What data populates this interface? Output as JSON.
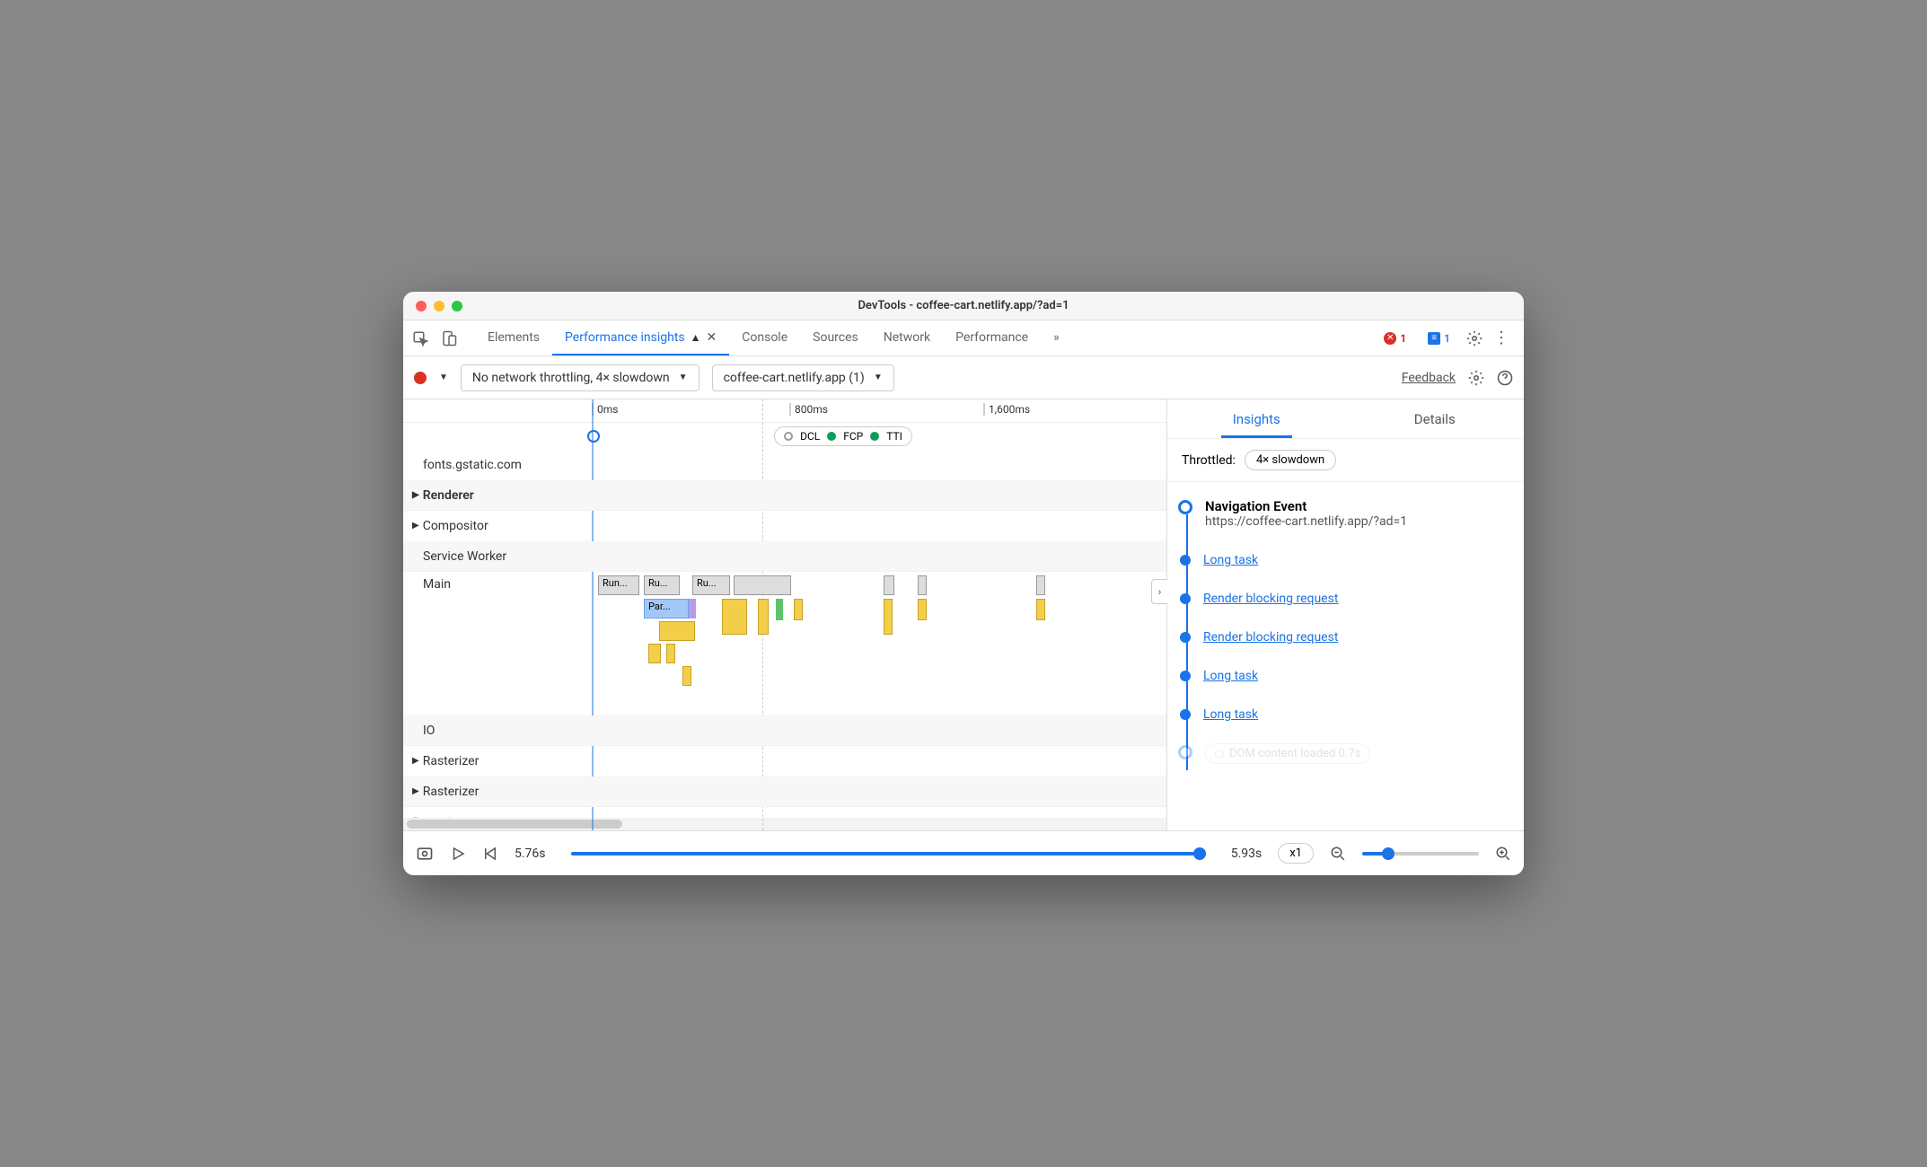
{
  "window": {
    "title": "DevTools - coffee-cart.netlify.app/?ad=1"
  },
  "tabs": {
    "items": [
      "Elements",
      "Performance insights",
      "Console",
      "Sources",
      "Network",
      "Performance"
    ],
    "active_index": 1,
    "more_glyph": "»",
    "error_count": "1",
    "info_count": "1"
  },
  "toolbar": {
    "throttling": "No network throttling, 4× slowdown",
    "target": "coffee-cart.netlify.app (1)",
    "feedback_label": "Feedback"
  },
  "ruler": {
    "ticks": [
      "0ms",
      "800ms",
      "1,600ms"
    ]
  },
  "markers": {
    "dcl": "DCL",
    "fcp": "FCP",
    "tti": "TTI"
  },
  "tracks": {
    "fonts": "fonts.gstatic.com",
    "renderer": "Renderer",
    "compositor": "Compositor",
    "service_worker": "Service Worker",
    "main": "Main",
    "io": "IO",
    "rasterizer": "Rasterizer"
  },
  "flame": {
    "run": "Run...",
    "run2": "Ru...",
    "run3": "Ru...",
    "par": "Par..."
  },
  "side": {
    "tabs": {
      "insights": "Insights",
      "details": "Details"
    },
    "throttled_label": "Throttled:",
    "throttled_value": "4× slowdown",
    "nav_title": "Navigation Event",
    "nav_url": "https://coffee-cart.netlify.app/?ad=1",
    "items": [
      "Long task",
      "Render blocking request",
      "Render blocking request",
      "Long task",
      "Long task"
    ],
    "dom_loaded": "DOM content loaded 0.7s"
  },
  "footer": {
    "time_start": "5.76s",
    "time_end": "5.93s",
    "speed": "x1"
  },
  "chart_data": {
    "type": "timeline",
    "x_unit": "ms",
    "x_range": [
      0,
      1600
    ],
    "markers": [
      {
        "name": "DCL",
        "time_ms": 700
      },
      {
        "name": "FCP",
        "time_ms": 800
      },
      {
        "name": "TTI",
        "time_ms": 850
      }
    ],
    "tracks": [
      {
        "name": "fonts.gstatic.com",
        "events": []
      },
      {
        "name": "Renderer",
        "events": []
      },
      {
        "name": "Compositor",
        "events": []
      },
      {
        "name": "Service Worker",
        "events": []
      },
      {
        "name": "Main",
        "events": [
          {
            "label": "Run...",
            "start_ms": 10,
            "dur_ms": 110,
            "depth": 0,
            "color": "gray"
          },
          {
            "label": "Ru...",
            "start_ms": 125,
            "dur_ms": 70,
            "depth": 0,
            "color": "gray"
          },
          {
            "label": "Ru...",
            "start_ms": 200,
            "dur_ms": 70,
            "depth": 0,
            "color": "gray"
          },
          {
            "label": "Par...",
            "start_ms": 130,
            "dur_ms": 100,
            "depth": 1,
            "color": "blue"
          },
          {
            "label": "",
            "start_ms": 140,
            "dur_ms": 90,
            "depth": 2,
            "color": "yellow"
          },
          {
            "label": "",
            "start_ms": 270,
            "dur_ms": 90,
            "depth": 1,
            "color": "yellow"
          },
          {
            "label": "",
            "start_ms": 700,
            "dur_ms": 40,
            "depth": 0,
            "color": "yellow"
          },
          {
            "label": "",
            "start_ms": 950,
            "dur_ms": 8,
            "depth": 0,
            "color": "yellow"
          }
        ]
      },
      {
        "name": "IO",
        "events": []
      },
      {
        "name": "Rasterizer",
        "events": []
      },
      {
        "name": "Rasterizer",
        "events": []
      }
    ]
  }
}
